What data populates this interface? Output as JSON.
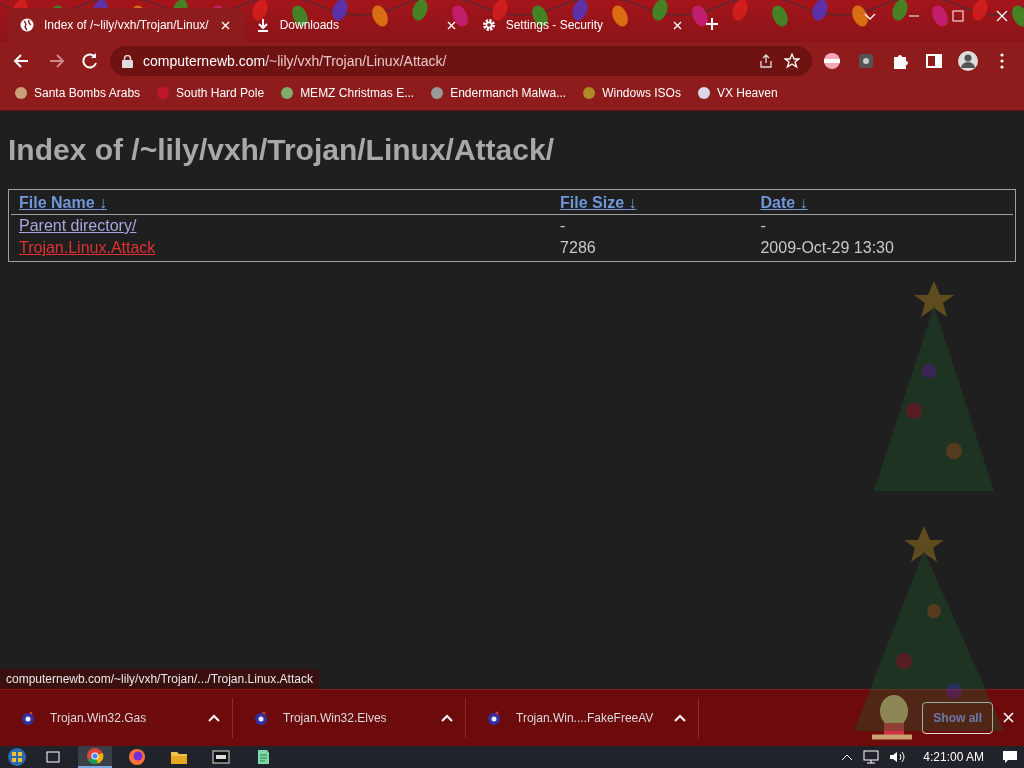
{
  "tabs": [
    {
      "title": "Index of /~lily/vxh/Trojan/Linux/",
      "kind": "page",
      "selected": true
    },
    {
      "title": "Downloads",
      "kind": "downloads",
      "selected": false
    },
    {
      "title": "Settings - Security",
      "kind": "settings",
      "selected": false
    }
  ],
  "address": {
    "host": "computernewb.com",
    "path": "/~lily/vxh/Trojan/Linux/Attack/"
  },
  "bookmarks": [
    {
      "title": "Santa Bombs Arabs",
      "color": "#c9a27a"
    },
    {
      "title": "South Hard Pole",
      "color": "#c0182a"
    },
    {
      "title": "MEMZ Christmas E...",
      "color": "#7fae6a"
    },
    {
      "title": "Endermanch Malwa...",
      "color": "#9a9a9a"
    },
    {
      "title": "Windows ISOs",
      "color": "#b08a2a"
    },
    {
      "title": "VX Heaven",
      "color": "#d8d8e8"
    }
  ],
  "page": {
    "heading": "Index of /~lily/vxh/Trojan/Linux/Attack/",
    "columns": [
      {
        "label": "File Name",
        "arrow": "↓"
      },
      {
        "label": "File Size",
        "arrow": "↓"
      },
      {
        "label": "Date",
        "arrow": "↓"
      }
    ],
    "rows": [
      {
        "name": "Parent directory/",
        "size": "-",
        "date": "-",
        "hovered": false
      },
      {
        "name": "Trojan.Linux.Attack",
        "size": "7286",
        "date": "2009-Oct-29 13:30",
        "hovered": true
      }
    ]
  },
  "status_url": "computernewb.com/~lily/vxh/Trojan/.../Trojan.Linux.Attack",
  "downloads": [
    {
      "name": "Trojan.Win32.Gas"
    },
    {
      "name": "Trojan.Win32.Elves"
    },
    {
      "name": "Trojan.Win....FakeFreeAV"
    }
  ],
  "show_all": "Show all",
  "taskbar": {
    "apps": [
      {
        "kind": "chrome",
        "selected": true
      },
      {
        "kind": "firefox",
        "selected": false
      },
      {
        "kind": "folder",
        "selected": false
      },
      {
        "kind": "archive",
        "selected": false
      },
      {
        "kind": "notepad",
        "selected": false
      }
    ],
    "clock": "4:21:00 AM"
  }
}
